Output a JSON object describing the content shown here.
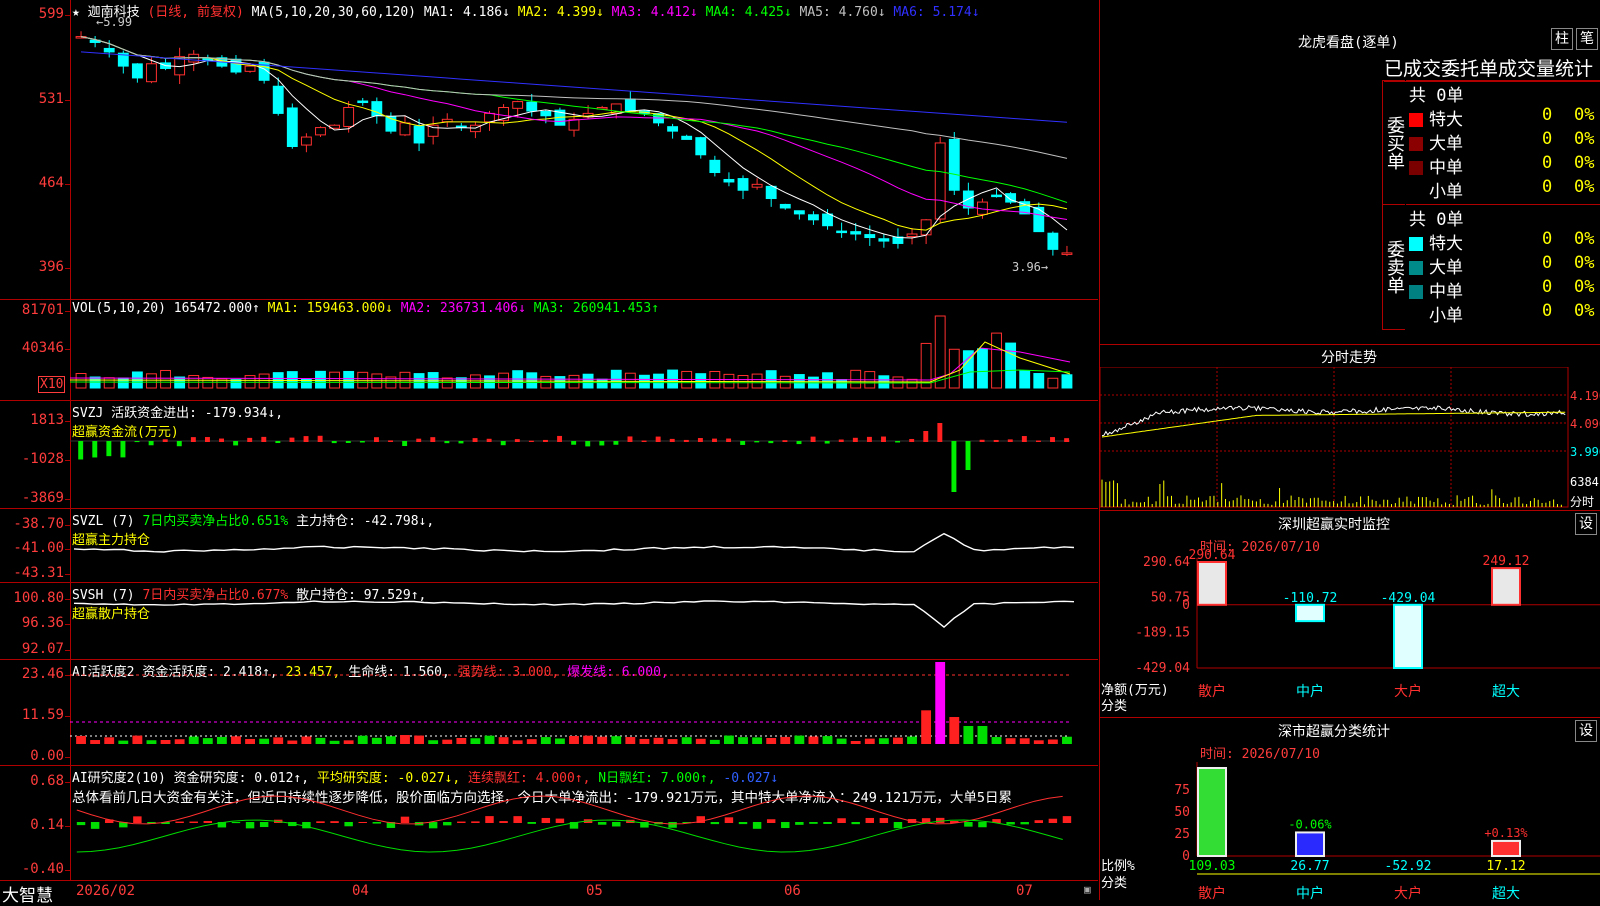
{
  "kline": {
    "title": "★ 迦南科技",
    "period": "(日线, 前复权)",
    "ma_label": "MA(5,10,20,30,60,120)",
    "ma": [
      {
        "label": "MA1:",
        "value": "4.186↓",
        "color": "#ffffff"
      },
      {
        "label": "MA2:",
        "value": "4.399↓",
        "color": "#ffff00"
      },
      {
        "label": "MA3:",
        "value": "4.412↓",
        "color": "#ff00ff"
      },
      {
        "label": "MA4:",
        "value": "4.425↓",
        "color": "#00ff00"
      },
      {
        "label": "MA5:",
        "value": "4.760↓",
        "color": "#c0c0c0"
      },
      {
        "label": "MA6:",
        "value": "5.174↓",
        "color": "#3030ff"
      }
    ],
    "y_ticks": [
      "599",
      "531",
      "464",
      "396"
    ],
    "high_label": "←5.99",
    "low_label": "3.96→",
    "chart_data": {
      "type": "candlestick",
      "close_series": [
        5.85,
        5.8,
        5.72,
        5.6,
        5.5,
        5.62,
        5.58,
        5.68,
        5.7,
        5.65,
        5.6,
        5.55,
        5.6,
        5.48,
        5.2,
        4.92,
        5.0,
        5.08,
        5.1,
        5.25,
        5.3,
        5.18,
        5.05,
        5.12,
        4.95,
        5.1,
        5.15,
        5.08,
        5.1,
        5.2,
        5.25,
        5.3,
        5.22,
        5.18,
        5.1,
        5.15,
        5.2,
        5.25,
        5.28,
        5.22,
        5.2,
        5.12,
        5.05,
        4.98,
        4.85,
        4.7,
        4.62,
        4.55,
        4.6,
        4.48,
        4.4,
        4.35,
        4.3,
        4.25,
        4.2,
        4.18,
        4.15,
        4.12,
        4.1,
        4.18,
        4.3,
        4.95,
        4.55,
        4.4,
        4.45,
        4.5,
        4.45,
        4.35,
        4.2,
        4.05,
        4.02
      ]
    }
  },
  "vol": {
    "label": "VOL(5,10,20)",
    "value": "165472.000↑",
    "ma1": "MA1: 159463.000↓",
    "ma2": "MA2: 236731.406↓",
    "ma3": "MA3: 260941.453↑",
    "y_ticks": [
      "81701",
      "40346"
    ],
    "unit": "X10"
  },
  "svzj": {
    "label": "SVZJ",
    "desc": "活跃资金进出: -179.934↓,",
    "sub": "超赢资金流(万元)",
    "y_ticks": [
      "1813",
      "-1028",
      "-3869"
    ]
  },
  "svzl": {
    "label": "SVZL (7)",
    "pct": "7日内买卖净占比0.651%",
    "main": "主力持仓: -42.798↓,",
    "sub": "超赢主力持仓",
    "y_ticks": [
      "-38.70",
      "-41.00",
      "-43.31"
    ]
  },
  "svsh": {
    "label": "SVSH (7)",
    "pct": "7日内买卖净占比0.677%",
    "main": "散户持仓: 97.529↑,",
    "sub": "超赢散户持仓",
    "y_ticks": [
      "100.80",
      "96.36",
      "92.07"
    ]
  },
  "ai1": {
    "label": "AI活跃度2",
    "a": "资金活跃度: 2.418↑,",
    "b": "23.457,",
    "c": "生命线: 1.560,",
    "d": "强势线: 3.000,",
    "e": "爆发线: 6.000,",
    "y_ticks": [
      "23.46",
      "11.59",
      "0.00"
    ]
  },
  "ai2": {
    "label": "AI研究度2(10)",
    "a": "资金研究度: 0.012↑,",
    "b": "平均研究度: -0.027↓,",
    "c": "连续飘红: 4.000↑,",
    "d": "N日飘红: 7.000↑,",
    "e": "-0.027↓",
    "text": "总体看前几日大资金有关注，但近日持续性逐步降低，股价面临方向选择，今日大单净流出：-179.921万元，其中特大单净流入：249.121万元，大单5日累",
    "y_ticks": [
      "0.68",
      "0.14",
      "-0.40"
    ]
  },
  "xaxis": {
    "brand": "大智慧",
    "months": [
      "2026/02",
      "04",
      "05",
      "06",
      "07"
    ]
  },
  "dragon": {
    "title": "龙虎看盘(逐单)",
    "btn1": "柱",
    "btn2": "笔",
    "tabs": "已成交委托单成交量统计",
    "buy_side": "委买单",
    "sell_side": "委卖单",
    "buy_total": "共 0单",
    "sell_total": "共 0单",
    "rows": [
      "特大",
      "大单",
      "中单",
      "小单"
    ],
    "count": "0",
    "pct": "0%",
    "buy_colors": [
      "#ff0000",
      "#8b0000",
      "#7a0000",
      ""
    ],
    "sell_colors": [
      "#00ffff",
      "#008b8b",
      "#008080",
      ""
    ]
  },
  "intraday": {
    "title": "分时走势",
    "y_ticks": [
      "4.190",
      "4.090",
      "3.990"
    ],
    "vol_tick": "6384",
    "unit": "分时"
  },
  "monitor": {
    "title": "深圳超赢实时监控",
    "btn": "设",
    "time": "时间: 2026/07/10",
    "y_ticks": [
      "290.64",
      "50.75",
      "0",
      "-189.15",
      "-429.04"
    ],
    "axis_label": "净额(万元)",
    "axis_label2": "分类",
    "categories": [
      "散户",
      "中户",
      "大户",
      "超大"
    ],
    "values": [
      "290.64",
      "-110.72",
      "-429.04",
      "249.12"
    ],
    "chart_data": {
      "type": "bar",
      "categories": [
        "散户",
        "中户",
        "大户",
        "超大"
      ],
      "values": [
        290.64,
        -110.72,
        -429.04,
        249.12
      ],
      "ylabel": "净额(万元)"
    }
  },
  "classify": {
    "title": "深市超赢分类统计",
    "btn": "设",
    "time": "时间: 2026/07/10",
    "y_ticks": [
      "75",
      "50",
      "25",
      "0"
    ],
    "axis_label": "比例%",
    "axis_label2": "分类",
    "categories": [
      "散户",
      "中户",
      "大户",
      "超大"
    ],
    "bottom_values": [
      "109.03",
      "26.77",
      "-52.92",
      "17.12"
    ],
    "top_values": [
      "",
      "-0.06%",
      "",
      "+0.13%"
    ],
    "chart_data": {
      "type": "bar",
      "categories": [
        "散户",
        "中户",
        "大户",
        "超大"
      ],
      "values": [
        109.03,
        26.77,
        -52.92,
        17.12
      ],
      "ylabel": "比例%"
    }
  }
}
